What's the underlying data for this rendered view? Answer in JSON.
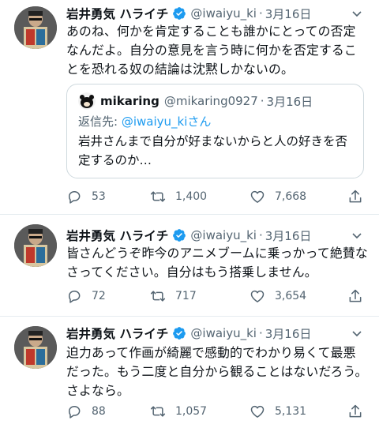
{
  "tweets": [
    {
      "name": "岩井勇気 ハライチ",
      "handle": "@iwaiyu_ki",
      "dot": "·",
      "date": "3月16日",
      "text": "あのね、何かを肯定することも誰かにとっての否定なんだよ。自分の意見を言う時に何かを否定することを恐れる奴の結論は沈黙しかないの。",
      "quote": {
        "name": "mikaring",
        "handle": "@mikaring0927",
        "dot": "·",
        "date": "3月16日",
        "reply_prefix": "返信先: ",
        "reply_mention": "@iwaiyu_kiさん",
        "text": "岩井さんまで自分が好まないからと人の好きを否定するのか…"
      },
      "replies": "53",
      "retweets": "1,400",
      "likes": "7,668"
    },
    {
      "name": "岩井勇気 ハライチ",
      "handle": "@iwaiyu_ki",
      "dot": "·",
      "date": "3月16日",
      "text": "皆さんどうぞ昨今のアニメブームに乗っかって絶賛なさってください。自分はもう搭乗しません。",
      "replies": "72",
      "retweets": "717",
      "likes": "3,654"
    },
    {
      "name": "岩井勇気 ハライチ",
      "handle": "@iwaiyu_ki",
      "dot": "·",
      "date": "3月16日",
      "text": "迫力あって作画が綺麗で感動的でわかり易くて最悪だった。もう二度と自分から観ることはないだろう。さよなら。",
      "replies": "88",
      "retweets": "1,057",
      "likes": "5,131"
    }
  ],
  "icons": {
    "verified": "verified-badge-icon",
    "more": "more-chevron-icon",
    "reply": "reply-bubble-icon",
    "retweet": "retweet-icon",
    "like": "heart-icon",
    "share": "share-icon"
  },
  "colors": {
    "verified": "#1d9bf0",
    "mention": "#1d9bf0",
    "muted": "#536471",
    "text": "#0f1419",
    "divider": "#e6ecf0"
  }
}
